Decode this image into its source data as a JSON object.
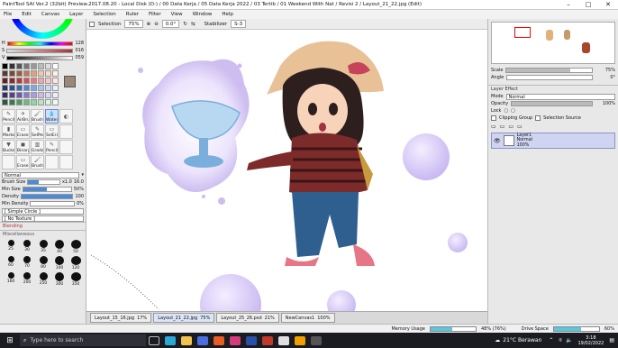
{
  "window": {
    "title": "PaintTool SAI Ver.2 (32bit) Preview.2017.08.20 - Local Disk (D:) / 00 Data Kerja / 05 Data Kerja 2022 / 03 Tertib / 01 Weekend With Nat / Revisi 2 / Layout_21_22.jpg (Edit)"
  },
  "menu": [
    "File",
    "Edit",
    "Canvas",
    "Layer",
    "Selection",
    "Ruler",
    "Filter",
    "View",
    "Window",
    "Help"
  ],
  "toolbar": {
    "selection_label": "Selection",
    "zoom": "75%",
    "angle": "0.0°",
    "stabilizer_label": "Stabilizer",
    "stabilizer_value": "S-3"
  },
  "color": {
    "h_label": "H",
    "h_val": "128",
    "s_label": "S",
    "s_val": "016",
    "v_label": "V",
    "v_val": "059",
    "current_hex": "#9b8876"
  },
  "palette": [
    "#000000",
    "#333333",
    "#555555",
    "#777777",
    "#999999",
    "#bbbbbb",
    "#dddddd",
    "#ffffff",
    "#5a3a2a",
    "#7a4a30",
    "#9a5d3b",
    "#c07a52",
    "#e0a27a",
    "#f2c8a6",
    "#f8dcc6",
    "#fff0e0",
    "#6b1f1f",
    "#8f2a2a",
    "#b13a3a",
    "#d65050",
    "#e87a7a",
    "#f2a4a4",
    "#f8c8c8",
    "#ffe6e6",
    "#1f3b6b",
    "#2a528f",
    "#3a6bb1",
    "#5088d6",
    "#7aa8e8",
    "#a4c6f2",
    "#c8dcf8",
    "#e6f0ff",
    "#3b2a6b",
    "#52418f",
    "#6b58b1",
    "#8a78d6",
    "#a89ae8",
    "#c6bcf2",
    "#ddd6f8",
    "#f0ecff",
    "#2a5a3a",
    "#3a7a4e",
    "#4e9a66",
    "#6aba82",
    "#8ed6a2",
    "#b4e8c4",
    "#d6f4e0",
    "#eefcf2"
  ],
  "tools": [
    {
      "label": "Pencil",
      "icon": "✎"
    },
    {
      "label": "AirBrush",
      "icon": "✈"
    },
    {
      "label": "Brush",
      "icon": "🖌"
    },
    {
      "label": "Water",
      "icon": "💧"
    },
    {
      "label": "",
      "icon": "◐"
    },
    {
      "label": "Marker",
      "icon": "▮"
    },
    {
      "label": "Eraser",
      "icon": "▭"
    },
    {
      "label": "SelPen",
      "icon": "✎"
    },
    {
      "label": "SelEra",
      "icon": "▭"
    },
    {
      "label": "",
      "icon": ""
    },
    {
      "label": "Bucket",
      "icon": "▼"
    },
    {
      "label": "Binary",
      "icon": "◼"
    },
    {
      "label": "Gradati...",
      "icon": "▥"
    },
    {
      "label": "Pencil",
      "icon": "✎"
    },
    {
      "label": "",
      "icon": ""
    },
    {
      "label": "",
      "icon": ""
    },
    {
      "label": "Eraser",
      "icon": "▭"
    },
    {
      "label": "Brush",
      "icon": "🖌"
    },
    {
      "label": "",
      "icon": ""
    },
    {
      "label": "",
      "icon": ""
    }
  ],
  "brush": {
    "mode": "Normal",
    "size_label": "Brush Size",
    "size_mult": "x1.0",
    "size_val": "16.0",
    "minsize_label": "Min Size",
    "minsize_val": "50%",
    "density_label": "Density",
    "density_val": "100",
    "mindensity_label": "Min Density",
    "mindensity_val": "0%",
    "shape": "[ Simple Circle ]",
    "texture": "[ No Texture ]",
    "blending_label": "Blending",
    "misc_label": "Miscellaneous"
  },
  "brush_sizes": [
    {
      "label": "25",
      "d": 7
    },
    {
      "label": "30",
      "d": 8
    },
    {
      "label": "35",
      "d": 9
    },
    {
      "label": "40",
      "d": 10
    },
    {
      "label": "50",
      "d": 11
    },
    {
      "label": "60",
      "d": 7
    },
    {
      "label": "70",
      "d": 8
    },
    {
      "label": "80",
      "d": 9
    },
    {
      "label": "100",
      "d": 10
    },
    {
      "label": "120",
      "d": 11
    },
    {
      "label": "160",
      "d": 7
    },
    {
      "label": "200",
      "d": 8
    },
    {
      "label": "250",
      "d": 9
    },
    {
      "label": "300",
      "d": 10
    },
    {
      "label": "350",
      "d": 11
    }
  ],
  "navigator": {
    "scale_label": "Scale",
    "scale_val": "75%",
    "angle_label": "Angle",
    "angle_val": "0°"
  },
  "layer": {
    "effect_label": "Layer Effect",
    "mode_label": "Mode",
    "mode_val": "Normal",
    "opacity_label": "Opacity",
    "opacity_val": "100%",
    "lock_label": "Lock",
    "clipping_label": "Clipping Group",
    "selsrc_label": "Selection Source",
    "item_name": "Layer1",
    "item_mode": "Normal",
    "item_opacity": "100%"
  },
  "doctabs": [
    {
      "name": "Layout_15_16.jpg",
      "zoom": "17%",
      "active": false
    },
    {
      "name": "Layout_21_22.jpg",
      "zoom": "75%",
      "active": true
    },
    {
      "name": "Layout_25_26.psd",
      "zoom": "21%",
      "active": false
    },
    {
      "name": "NewCanvas1",
      "zoom": "100%",
      "active": false
    }
  ],
  "status": {
    "mem_label": "Memory Usage",
    "mem_val": "48% (76%)",
    "mem_fraction": 0.48,
    "drive_label": "Drive Space",
    "drive_val": "60%",
    "drive_fraction": 0.6
  },
  "taskbar": {
    "search_placeholder": "Type here to search",
    "weather": "21°C  Berawan",
    "time": "3:18",
    "date": "19/02/2022"
  },
  "colors": {
    "accent": "#56c8e2",
    "selection": "#cfe0f6",
    "canvas_bg": "#ffffff"
  }
}
